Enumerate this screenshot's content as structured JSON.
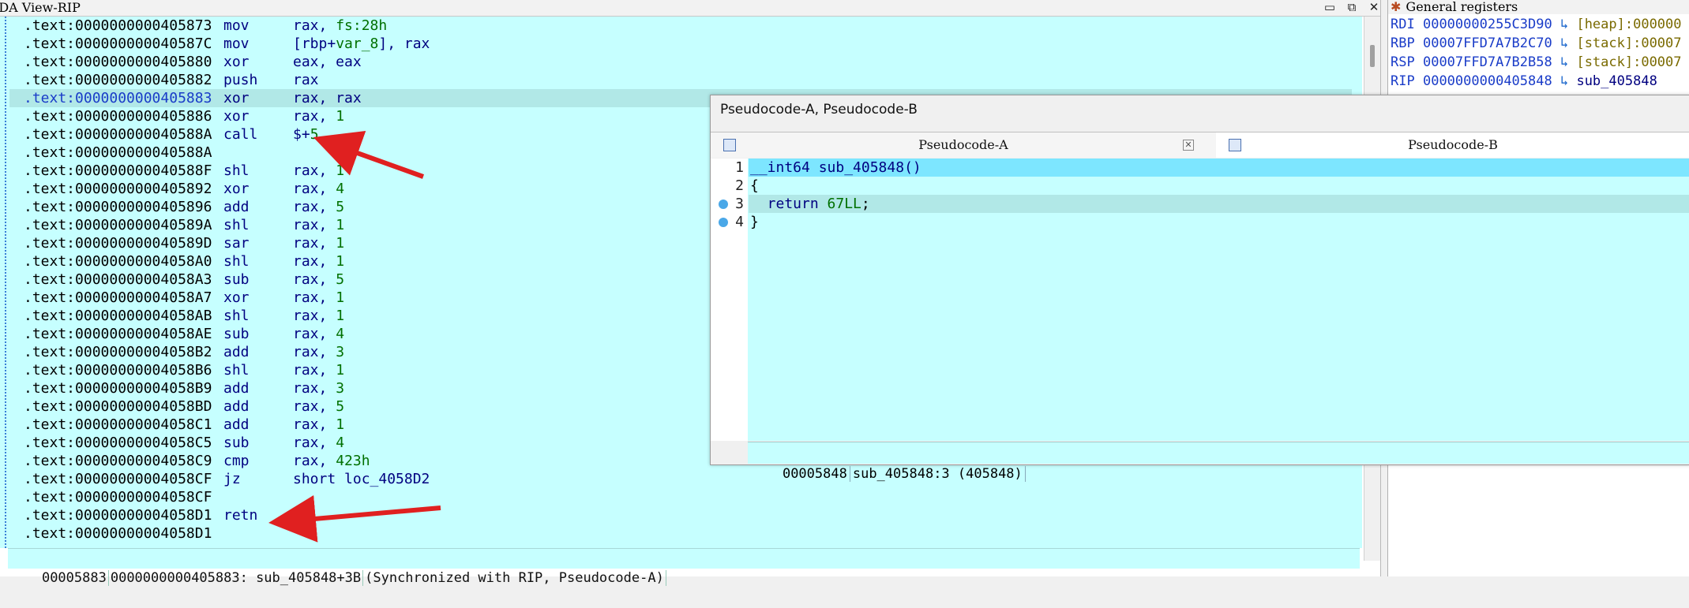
{
  "ida_view": {
    "title": "IDA View-RIP",
    "lines": [
      {
        "addr": ".text:0000000000405873",
        "mnem": "mov",
        "ops": [
          {
            "t": "rax, ",
            "c": "op"
          },
          {
            "t": "fs:28h",
            "c": "num"
          }
        ]
      },
      {
        "addr": ".text:000000000040587C",
        "mnem": "mov",
        "ops": [
          {
            "t": "[rbp+",
            "c": "op"
          },
          {
            "t": "var_8",
            "c": "num"
          },
          {
            "t": "], rax",
            "c": "op"
          }
        ]
      },
      {
        "addr": ".text:0000000000405880",
        "mnem": "xor",
        "ops": [
          {
            "t": "eax, eax",
            "c": "op"
          }
        ]
      },
      {
        "addr": ".text:0000000000405882",
        "mnem": "push",
        "ops": [
          {
            "t": "rax",
            "c": "op"
          }
        ]
      },
      {
        "addr": ".text:0000000000405883",
        "mnem": "xor",
        "ops": [
          {
            "t": "rax, rax",
            "c": "op"
          }
        ],
        "current": true
      },
      {
        "addr": ".text:0000000000405886",
        "mnem": "xor",
        "ops": [
          {
            "t": "rax, ",
            "c": "op"
          },
          {
            "t": "1",
            "c": "num"
          }
        ]
      },
      {
        "addr": ".text:000000000040588A",
        "mnem": "call",
        "ops": [
          {
            "t": "$+",
            "c": "op"
          },
          {
            "t": "5",
            "c": "num"
          }
        ]
      },
      {
        "addr": ".text:000000000040588A",
        "mnem": "",
        "ops": []
      },
      {
        "addr": ".text:000000000040588F",
        "mnem": "shl",
        "ops": [
          {
            "t": "rax, ",
            "c": "op"
          },
          {
            "t": "1",
            "c": "num"
          }
        ]
      },
      {
        "addr": ".text:0000000000405892",
        "mnem": "xor",
        "ops": [
          {
            "t": "rax, ",
            "c": "op"
          },
          {
            "t": "4",
            "c": "num"
          }
        ]
      },
      {
        "addr": ".text:0000000000405896",
        "mnem": "add",
        "ops": [
          {
            "t": "rax, ",
            "c": "op"
          },
          {
            "t": "5",
            "c": "num"
          }
        ]
      },
      {
        "addr": ".text:000000000040589A",
        "mnem": "shl",
        "ops": [
          {
            "t": "rax, ",
            "c": "op"
          },
          {
            "t": "1",
            "c": "num"
          }
        ]
      },
      {
        "addr": ".text:000000000040589D",
        "mnem": "sar",
        "ops": [
          {
            "t": "rax, ",
            "c": "op"
          },
          {
            "t": "1",
            "c": "num"
          }
        ]
      },
      {
        "addr": ".text:00000000004058A0",
        "mnem": "shl",
        "ops": [
          {
            "t": "rax, ",
            "c": "op"
          },
          {
            "t": "1",
            "c": "num"
          }
        ]
      },
      {
        "addr": ".text:00000000004058A3",
        "mnem": "sub",
        "ops": [
          {
            "t": "rax, ",
            "c": "op"
          },
          {
            "t": "5",
            "c": "num"
          }
        ]
      },
      {
        "addr": ".text:00000000004058A7",
        "mnem": "xor",
        "ops": [
          {
            "t": "rax, ",
            "c": "op"
          },
          {
            "t": "1",
            "c": "num"
          }
        ]
      },
      {
        "addr": ".text:00000000004058AB",
        "mnem": "shl",
        "ops": [
          {
            "t": "rax, ",
            "c": "op"
          },
          {
            "t": "1",
            "c": "num"
          }
        ]
      },
      {
        "addr": ".text:00000000004058AE",
        "mnem": "sub",
        "ops": [
          {
            "t": "rax, ",
            "c": "op"
          },
          {
            "t": "4",
            "c": "num"
          }
        ]
      },
      {
        "addr": ".text:00000000004058B2",
        "mnem": "add",
        "ops": [
          {
            "t": "rax, ",
            "c": "op"
          },
          {
            "t": "3",
            "c": "num"
          }
        ]
      },
      {
        "addr": ".text:00000000004058B6",
        "mnem": "shl",
        "ops": [
          {
            "t": "rax, ",
            "c": "op"
          },
          {
            "t": "1",
            "c": "num"
          }
        ]
      },
      {
        "addr": ".text:00000000004058B9",
        "mnem": "add",
        "ops": [
          {
            "t": "rax, ",
            "c": "op"
          },
          {
            "t": "3",
            "c": "num"
          }
        ]
      },
      {
        "addr": ".text:00000000004058BD",
        "mnem": "add",
        "ops": [
          {
            "t": "rax, ",
            "c": "op"
          },
          {
            "t": "5",
            "c": "num"
          }
        ]
      },
      {
        "addr": ".text:00000000004058C1",
        "mnem": "add",
        "ops": [
          {
            "t": "rax, ",
            "c": "op"
          },
          {
            "t": "1",
            "c": "num"
          }
        ]
      },
      {
        "addr": ".text:00000000004058C5",
        "mnem": "sub",
        "ops": [
          {
            "t": "rax, ",
            "c": "op"
          },
          {
            "t": "4",
            "c": "num"
          }
        ]
      },
      {
        "addr": ".text:00000000004058C9",
        "mnem": "cmp",
        "ops": [
          {
            "t": "rax, ",
            "c": "op"
          },
          {
            "t": "423h",
            "c": "num"
          }
        ]
      },
      {
        "addr": ".text:00000000004058CF",
        "mnem": "jz",
        "ops": [
          {
            "t": "short loc_4058D2",
            "c": "op"
          }
        ]
      },
      {
        "addr": ".text:00000000004058CF",
        "mnem": "",
        "ops": []
      },
      {
        "addr": ".text:00000000004058D1",
        "mnem": "retn",
        "ops": []
      },
      {
        "addr": ".text:00000000004058D1",
        "mnem": "",
        "ops": []
      }
    ],
    "status": [
      "00005883",
      "0000000000405883: sub_405848+3B",
      "(Synchronized with RIP, Pseudocode-A)"
    ]
  },
  "registers": {
    "title": "General registers",
    "rows": [
      {
        "name": "RDI",
        "value": "00000000255C3D90",
        "kind": "[heap]:000000",
        "kind_color": "#7a6a00"
      },
      {
        "name": "RBP",
        "value": "00007FFD7A7B2C70",
        "kind": "[stack]:00007",
        "kind_color": "#7a6a00"
      },
      {
        "name": "RSP",
        "value": "00007FFD7A7B2B58",
        "kind": "[stack]:00007",
        "kind_color": "#7a6a00"
      },
      {
        "name": "RIP",
        "value": "0000000000405848",
        "kind": "sub_405848",
        "kind_color": "#000080"
      }
    ]
  },
  "pseudocode": {
    "window_title": "Pseudocode-A, Pseudocode-B",
    "tab_a": "Pseudocode-A",
    "tab_b": "Pseudocode-B",
    "lines": [
      {
        "n": "1",
        "bp": false,
        "parts": [
          {
            "t": "__int64 sub_405848()",
            "c": "fn"
          }
        ]
      },
      {
        "n": "2",
        "bp": false,
        "parts": [
          {
            "t": "{",
            "c": ""
          }
        ]
      },
      {
        "n": "3",
        "bp": true,
        "parts": [
          {
            "t": "  return ",
            "c": "kw"
          },
          {
            "t": "67LL",
            "c": "lit"
          },
          {
            "t": ";",
            "c": ""
          }
        ]
      },
      {
        "n": "4",
        "bp": true,
        "parts": [
          {
            "t": "}",
            "c": ""
          }
        ]
      }
    ],
    "status": [
      "00005848",
      "sub_405848:3 (405848)"
    ]
  }
}
